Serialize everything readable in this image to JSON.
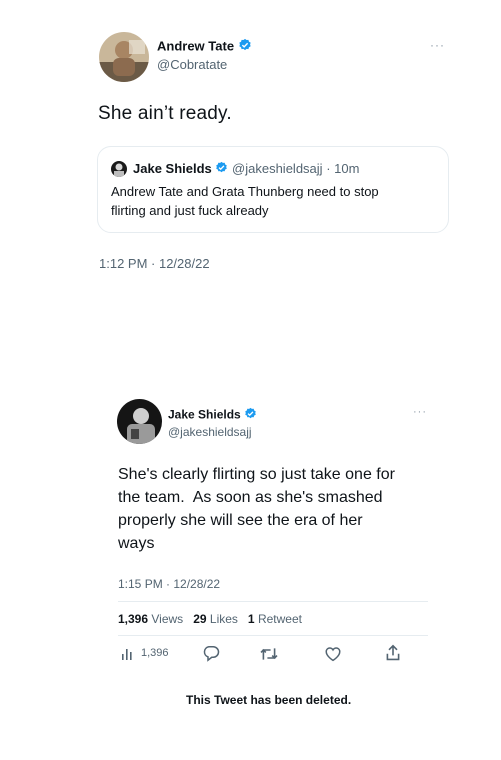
{
  "tweet1": {
    "author_name": "Andrew Tate",
    "author_handle": "@Cobratate",
    "more": "···",
    "text": "She ain’t ready.",
    "timestamp": "1:12 PM · 12/28/22",
    "quote": {
      "author_name": "Jake Shields",
      "author_handle": "@jakeshieldsajj",
      "time": "10m",
      "separator": "·",
      "text_line1": "Andrew Tate and Grata Thunberg need to stop",
      "text_line2": "flirting and just fuck already"
    }
  },
  "tweet2": {
    "author_name": "Jake Shields",
    "author_handle": "@jakeshieldsajj",
    "more": "···",
    "text_line1": "She's clearly flirting so just take one for",
    "text_line2": "the team.  As soon as she's smashed",
    "text_line3": "properly she will see the era of her",
    "text_line4": "ways",
    "timestamp": "1:15 PM · 12/28/22",
    "stats": {
      "views_count": "1,396",
      "views_label": "Views",
      "likes_count": "29",
      "likes_label": "Likes",
      "retweets_count": "1",
      "retweets_label": "Retweet"
    },
    "actions": {
      "views_count": "1,396"
    }
  },
  "deleted_notice": "This Tweet has been deleted.",
  "colors": {
    "verified_blue": "#1d9bf0",
    "text": "#0f1419",
    "muted": "#536471",
    "border": "#e6ecf0"
  },
  "icons": [
    "verified-badge-icon",
    "more-icon",
    "views-icon",
    "reply-icon",
    "retweet-icon",
    "like-icon",
    "share-icon"
  ]
}
